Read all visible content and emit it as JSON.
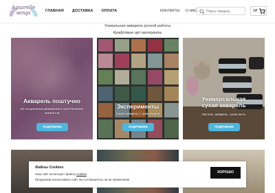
{
  "header": {
    "logo_text_line1": "Aquarelle",
    "logo_text_line2": "wings",
    "nav": [
      "ГЛАВНАЯ",
      "ДОСТАВКА",
      "ОПЛАТА"
    ],
    "nav_right": [
      "КОНТАКТЫ",
      "О НАС"
    ],
    "search_placeholder": "Поиск товаров...",
    "search_icon": "search-icon",
    "cart_count": "0₽",
    "cart_icon": "cart-icon"
  },
  "intro": {
    "line1": "Уникальная акварель ручной работы",
    "line2": "Крафтовые арт материалы"
  },
  "cards": [
    {
      "title": "Акварель поштучно",
      "subtitle": "Из натуральных минералов и синтетических пигментов",
      "button": "ПОДРОБНЕЕ"
    },
    {
      "title": "Эксперименты",
      "subtitle": "Серия акварели с грануляцией",
      "button": "ПОДРОБНЕЕ"
    },
    {
      "title_line1": "Универсальная",
      "title_line2": "сухая акварель",
      "subtitle": "Пастель, акварель, сухая кисть",
      "button": "ПОДРОБНЕЕ"
    }
  ],
  "cookie": {
    "title": "Файлы Cookies",
    "text1_prefix": "Наш сайт использует файлы ",
    "text1_link": "cookies",
    "text1_suffix": ".",
    "text2": "Продолжая использовать сайт, вы соглашаетесь на их применение.",
    "button": "ХОРОШО"
  },
  "colors": {
    "accent_button": "#4fb6dd",
    "cookie_button": "#111111"
  }
}
